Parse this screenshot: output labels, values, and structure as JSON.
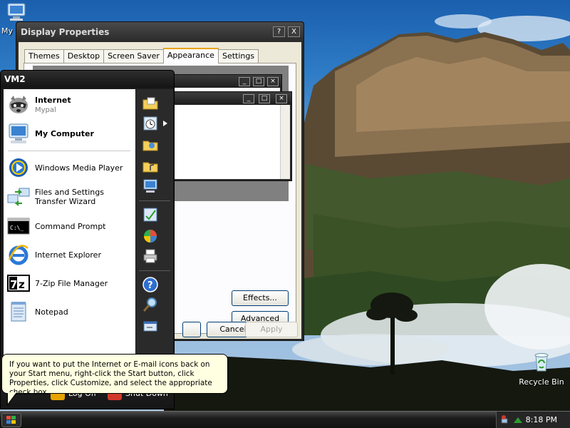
{
  "desktop": {
    "icons": [
      {
        "label": "My",
        "icon": "my-computer-icon"
      },
      {
        "label": "Recycle Bin",
        "icon": "recycle-bin-icon"
      }
    ]
  },
  "display_properties": {
    "title": "Display Properties",
    "help_btn": "?",
    "close_btn": "X",
    "tabs": [
      "Themes",
      "Desktop",
      "Screen Saver",
      "Appearance",
      "Settings"
    ],
    "active_tab": "Appearance",
    "effects_label": "Effects...",
    "advanced_label": "Advanced",
    "ok_label": "",
    "cancel_label": "Cancel",
    "apply_label": "Apply"
  },
  "start_menu": {
    "user": "VM2",
    "pinned": [
      {
        "label": "Internet",
        "sub": "Mypal",
        "icon": "raccoon-browser-icon"
      },
      {
        "label": "My Computer",
        "icon": "my-computer-icon"
      }
    ],
    "programs": [
      {
        "label": "Windows Media Player",
        "icon": "media-player-icon"
      },
      {
        "label": "Files and Settings Transfer Wizard",
        "icon": "transfer-wizard-icon"
      },
      {
        "label": "Command Prompt",
        "icon": "command-prompt-icon"
      },
      {
        "label": "Internet Explorer",
        "icon": "internet-explorer-icon"
      },
      {
        "label": "7-Zip File Manager",
        "icon": "seven-zip-icon"
      },
      {
        "label": "Notepad",
        "icon": "notepad-icon"
      }
    ],
    "right_icons": [
      "my-documents-icon",
      "recent-documents-icon",
      "my-pictures-icon",
      "my-music-icon",
      "my-computer-icon",
      "control-panel-icon",
      "default-programs-icon",
      "printers-icon",
      "help-icon",
      "search-icon",
      "run-icon"
    ],
    "log_off_label": "Log Off",
    "shut_down_label": "Shut Down"
  },
  "balloon": {
    "text": "If you want to put the Internet or E-mail icons back on your Start menu, right-click the Start button, click Properties, click Customize, and select the appropriate check box."
  },
  "taskbar": {
    "clock": "8:18 PM"
  },
  "colors": {
    "title_bar": "#2a2a2a",
    "window_face": "#ece9d8",
    "tab_active_accent": "#e8a400",
    "balloon_bg": "#ffffe1",
    "taskbar": "#1c1c1c"
  }
}
